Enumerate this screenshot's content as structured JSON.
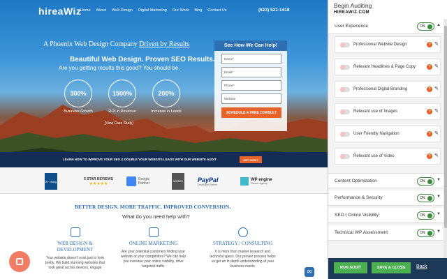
{
  "site": {
    "logo": "hireaWiz",
    "nav": [
      "Home",
      "About",
      "Web Design",
      "Digital Marketing",
      "Our Work",
      "Blog",
      "Contact Us"
    ],
    "phone": "(623) 521-1418",
    "tagline_prefix": "A Phoenix Web Design Company",
    "tagline_highlight": "Driven by Results",
    "headline": "Beautiful Web Design. Proven SEO Results.",
    "subheadline": "Are you getting results this good? You should be.",
    "stats": [
      {
        "value": "300%",
        "label": "Business Growth"
      },
      {
        "value": "1500%",
        "label": "ROI in Revenue"
      },
      {
        "value": "200%",
        "label": "Increase in Leads"
      }
    ],
    "view_case_study": "[View Case Study]",
    "form": {
      "title": "See How We Can Help!",
      "fields": [
        "Name*",
        "Email*",
        "Phone*",
        "Website"
      ],
      "submit": "SCHEDULE A FREE CONSULT"
    },
    "banner_text": "LEARN HOW TO IMPROVE YOUR SEO & DOUBLE YOUR WEBSITE LEADS WITH OUR WEBSITE AUDIT",
    "banner_button": "GET AUDIT",
    "badges": {
      "bbb": "A+ rating",
      "google_reviews": "5 STAR REVIEWS",
      "google_partner": "Google Partner",
      "agency": "AGENCY",
      "paypal": "PayPal",
      "paypal_sub": "Developer Partner",
      "wpengine": "WP engine",
      "wpengine_sub": "Partner Agency"
    },
    "section_heading": "BETTER DESIGN. MORE TRAFFIC. IMPROVED CONVERSION.",
    "section_sub": "What do you need help with?",
    "columns": [
      {
        "title": "WEB DESIGN & DEVELOPMENT",
        "text": "Your website doesn't exist just to look pretty. We build stunning websites that look great across devices, engage"
      },
      {
        "title": "ONLINE MARKETING",
        "text": "Are your potential customers finding your website or your competitors? We can help you increase your online visibility, drive targeted traffic"
      },
      {
        "title": "STRATEGY / CONSULTING",
        "text": "It is more than market research and technical specs. Our proven process helps us get an in depth understanding of your business needs"
      }
    ]
  },
  "panel": {
    "title": "Begin Auditing",
    "subtitle": "HIREAWIZ.COM",
    "categories": [
      {
        "label": "User Experience",
        "toggle": "ON",
        "expanded": true
      },
      {
        "label": "Content Optimization",
        "toggle": "ON"
      },
      {
        "label": "Performance & Security",
        "toggle": "ON"
      },
      {
        "label": "SEO / Online Visibility",
        "toggle": "ON"
      },
      {
        "label": "Technical WP Assessment",
        "toggle": "ON"
      }
    ],
    "items": [
      "Professional Website Design",
      "Relevant Headlines & Page Copy",
      "Professional Digital Branding",
      "Relevant use of Images",
      "User Friendly Navigation",
      "Relevant use of Video"
    ],
    "footer": {
      "run_audit": "RUN AUDIT",
      "save_close": "SAVE & CLOSE",
      "back": "Back"
    }
  },
  "colors": {
    "accent_blue": "#2c6fb3",
    "orange": "#e8632b",
    "green": "#4caf50",
    "panel_footer": "#1c3a57"
  }
}
